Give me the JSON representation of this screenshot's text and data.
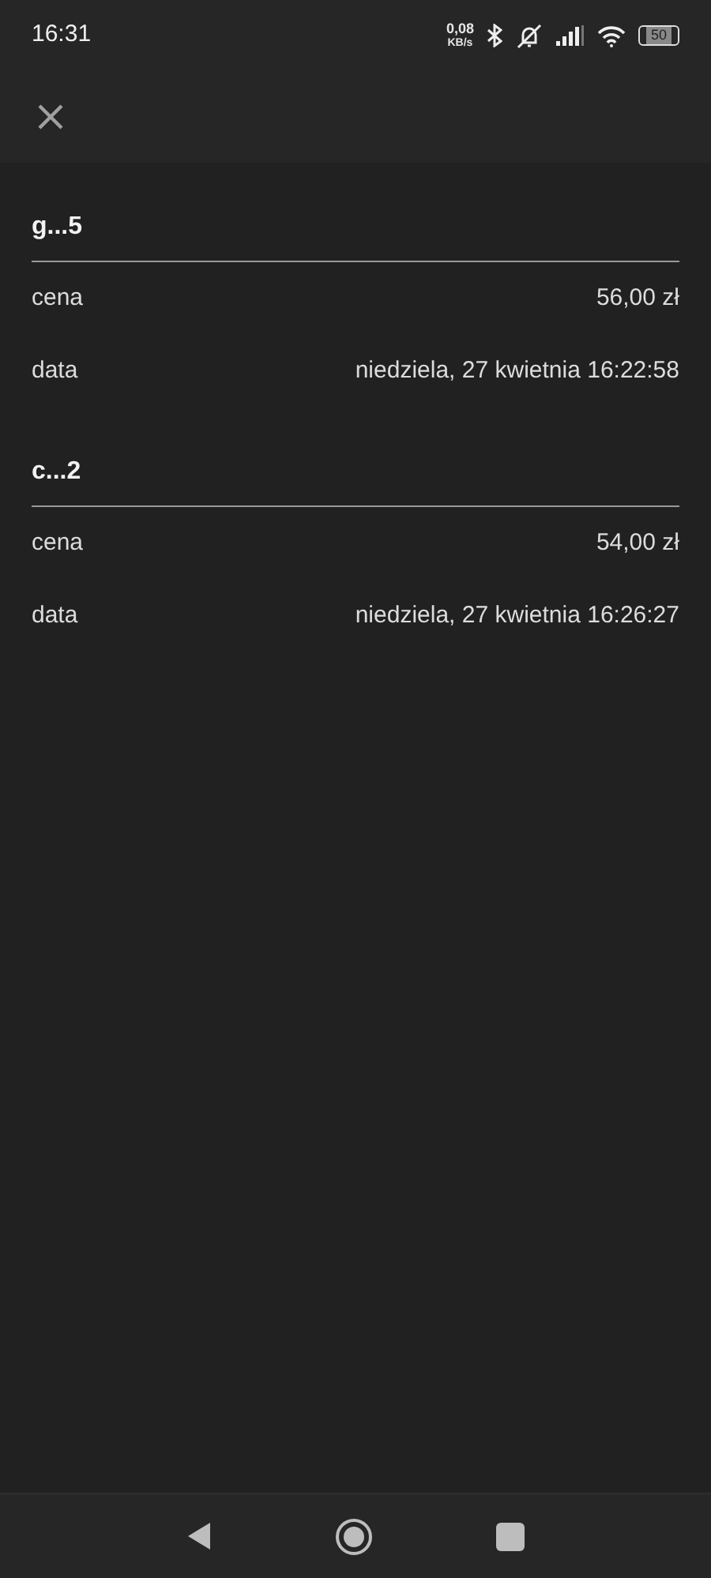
{
  "status_bar": {
    "time": "16:31",
    "net_speed": "0,08",
    "net_unit": "KB/s",
    "battery": "50"
  },
  "sections": [
    {
      "title": "g...5",
      "rows": [
        {
          "label": "cena",
          "value": "56,00 zł"
        },
        {
          "label": "data",
          "value": "niedziela, 27 kwietnia 16:22:58"
        }
      ]
    },
    {
      "title": "c...2",
      "rows": [
        {
          "label": "cena",
          "value": "54,00 zł"
        },
        {
          "label": "data",
          "value": "niedziela, 27 kwietnia 16:26:27"
        }
      ]
    }
  ]
}
